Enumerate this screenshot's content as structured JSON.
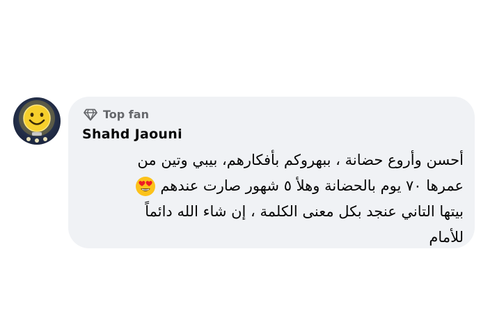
{
  "comment": {
    "avatar_icon": "smiley-lamp-avatar",
    "badge_icon": "diamond-icon",
    "badge_label": "Top fan",
    "author_name": "Shahd Jaouni",
    "lines": [
      "أحسن وأروع حضانة ، ببهروكم بأفكارهم، بيبي وتين من",
      "عمرها ٧٠ يوم بالحضانة وهلأ ٥ شهور صارت عندهم",
      "بيتها التاني عنجد بكل معنى الكلمة ، إن شاء الله دائماً",
      "للأمام"
    ],
    "emoji_icon": "heart-eyes-emoji-icon"
  },
  "colors": {
    "bubble_bg": "#f0f2f5",
    "muted_text": "#65676b",
    "primary_text": "#050505"
  }
}
